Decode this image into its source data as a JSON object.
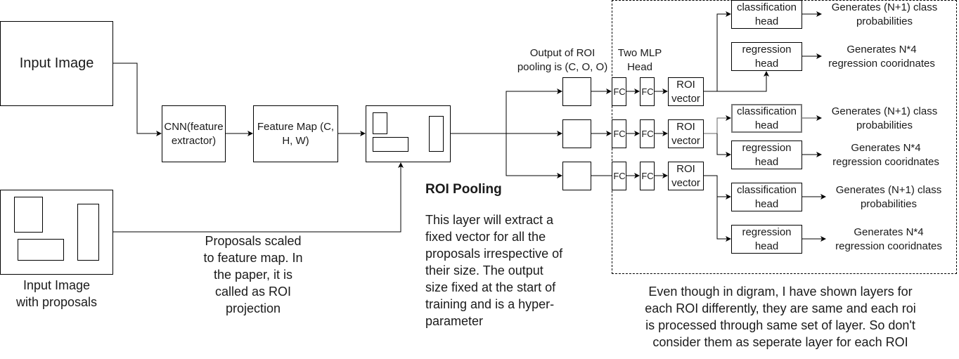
{
  "diagram": {
    "input_image": {
      "label": "Input Image"
    },
    "input_with_proposals": {
      "caption_line1": "Input Image",
      "caption_line2": "with proposals"
    },
    "cnn": {
      "line1": "CNN(feature",
      "line2": "extractor)"
    },
    "feature_map": {
      "line1": "Feature Map (C,",
      "line2": "H, W)"
    },
    "projection_note": {
      "lines": [
        "Proposals scaled",
        "to feature  map. In",
        "the paper, it is",
        "called as ROI",
        "projection"
      ]
    },
    "roi_pooling": {
      "title": "ROI Pooling",
      "description_lines": [
        "This layer will extract a",
        "fixed vector for all the",
        "proposals irrespective of",
        "their size. The output",
        "size fixed at the start of",
        "training and is a hyper-",
        "parameter"
      ]
    },
    "pool_output_label": {
      "line1": "Output of ROI",
      "line2": "pooling is (C, O, O)"
    },
    "mlp_label": {
      "line1": "Two MLP",
      "line2": "Head"
    },
    "fc_label": "FC",
    "roi_vector": {
      "line1": "ROI",
      "line2": "vector"
    },
    "classification_head": {
      "line1": "classification",
      "line2": "head"
    },
    "regression_head": {
      "line1": "regression",
      "line2": "head"
    },
    "class_output": {
      "line1": "Generates (N+1) class",
      "line2": "probabilities"
    },
    "reg_output": {
      "line1": "Generates N*4",
      "line2": "regression cooridnates"
    },
    "bottom_note": {
      "lines": [
        "Even though in digram, I have shown layers for",
        "each ROI differently, they are same and each roi",
        "is processed through same set of layer. So don't",
        "consider them as seperate layer for each ROI"
      ]
    }
  }
}
